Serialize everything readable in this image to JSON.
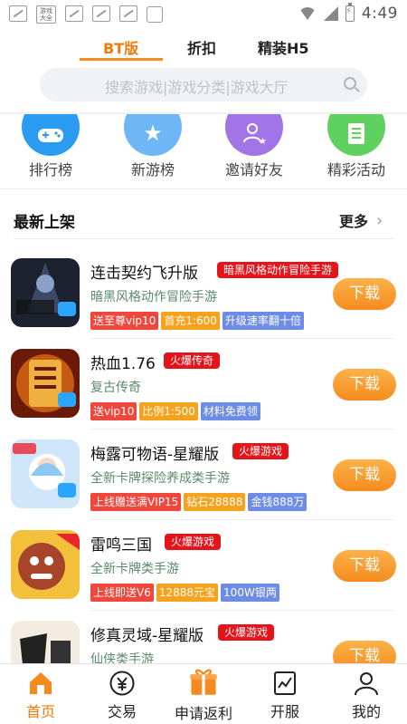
{
  "status_bar": {
    "app_icon_label": "游戏大全",
    "time": "4:49"
  },
  "top_tabs": [
    {
      "label": "BT版",
      "active": true
    },
    {
      "label": "折扣",
      "active": false
    },
    {
      "label": "精装H5",
      "active": false
    }
  ],
  "search": {
    "placeholder": "搜索游戏|游戏分类|游戏大厅"
  },
  "quick_nav": [
    {
      "label": "排行榜",
      "icon": "gamepad-icon",
      "color": "#2b9cf2"
    },
    {
      "label": "新游榜",
      "icon": "star-icon",
      "color": "#6fb6f6"
    },
    {
      "label": "邀请好友",
      "icon": "invite-user-icon",
      "color": "#a174e8"
    },
    {
      "label": "精彩活动",
      "icon": "document-icon",
      "color": "#5fd15f"
    }
  ],
  "section": {
    "title": "最新上架",
    "more_label": "更多"
  },
  "games": [
    {
      "name": "连击契约飞升版",
      "badge": "暗黑风格动作冒险手游",
      "desc": "暗黑风格动作冒险手游",
      "tags": [
        {
          "text": "送至尊vip10",
          "color": "red"
        },
        {
          "text": "首充1:600",
          "color": "orange"
        },
        {
          "text": "升级速率翻十倍",
          "color": "blue"
        }
      ],
      "download_label": "下载"
    },
    {
      "name": "热血1.76",
      "badge": "火爆传奇",
      "desc": "复古传奇",
      "tags": [
        {
          "text": "送vip10",
          "color": "red"
        },
        {
          "text": "比例1:500",
          "color": "orange"
        },
        {
          "text": "材料免费领",
          "color": "blue"
        }
      ],
      "download_label": "下载"
    },
    {
      "name": "梅露可物语-星耀版",
      "badge": "火爆游戏",
      "desc": "全新卡牌探险养成类手游",
      "tags": [
        {
          "text": "上线赠送满VIP15",
          "color": "red"
        },
        {
          "text": "钻石28888",
          "color": "orange"
        },
        {
          "text": "金钱888万",
          "color": "blue"
        }
      ],
      "download_label": "下载"
    },
    {
      "name": "雷鸣三国",
      "badge": "火爆游戏",
      "desc": "全新卡牌类手游",
      "tags": [
        {
          "text": "上线即送V6",
          "color": "red"
        },
        {
          "text": "12888元宝",
          "color": "orange"
        },
        {
          "text": "100W银两",
          "color": "blue"
        }
      ],
      "download_label": "下载"
    },
    {
      "name": "修真灵域-星耀版",
      "badge": "火爆游戏",
      "desc": "仙侠类手游",
      "tags": [],
      "download_label": "下载"
    }
  ],
  "bottom_nav": [
    {
      "label": "首页",
      "icon": "home-icon",
      "active": true
    },
    {
      "label": "交易",
      "icon": "yen-icon",
      "active": false
    },
    {
      "label": "申请返利",
      "icon": "gift-icon",
      "active": false
    },
    {
      "label": "开服",
      "icon": "chart-icon",
      "active": false
    },
    {
      "label": "我的",
      "icon": "user-icon",
      "active": false
    }
  ],
  "colors": {
    "accent": "#f07b0a",
    "badge_red": "#e5141b",
    "download_orange": "#f68c1e"
  }
}
